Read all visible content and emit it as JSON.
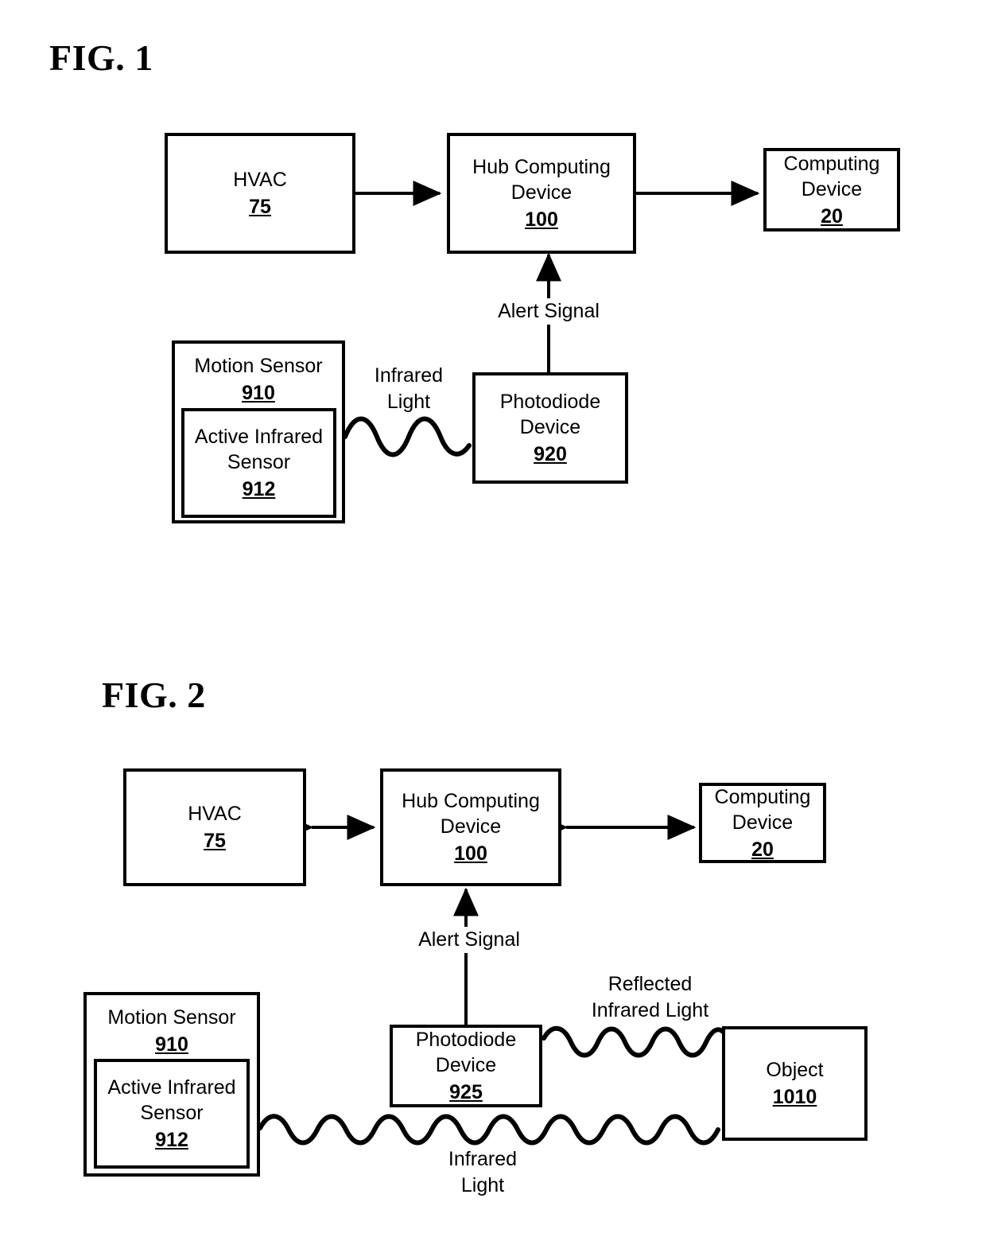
{
  "document": {
    "type": "patent-figure-sheet",
    "figures": [
      {
        "id": "fig1",
        "title": "FIG. 1",
        "nodes": [
          {
            "id": "hvac",
            "title": "HVAC",
            "ref": "75"
          },
          {
            "id": "hub",
            "title": "Hub Computing\nDevice",
            "ref": "100"
          },
          {
            "id": "computing",
            "title": "Computing\nDevice",
            "ref": "20"
          },
          {
            "id": "motion",
            "title": "Motion Sensor",
            "ref": "910"
          },
          {
            "id": "activeir",
            "title": "Active\nInfrared\nSensor",
            "ref": "912"
          },
          {
            "id": "photodiode",
            "title": "Photodiode\nDevice",
            "ref": "920"
          }
        ],
        "edge_labels": [
          {
            "id": "alert",
            "text": "Alert Signal"
          },
          {
            "id": "infrared",
            "text": "Infrared\nLight"
          }
        ]
      },
      {
        "id": "fig2",
        "title": "FIG. 2",
        "nodes": [
          {
            "id": "hvac",
            "title": "HVAC",
            "ref": "75"
          },
          {
            "id": "hub",
            "title": "Hub Computing\nDevice",
            "ref": "100"
          },
          {
            "id": "computing",
            "title": "Computing\nDevice",
            "ref": "20"
          },
          {
            "id": "motion",
            "title": "Motion Sensor",
            "ref": "910"
          },
          {
            "id": "activeir",
            "title": "Active\nInfrared\nSensor",
            "ref": "912"
          },
          {
            "id": "photodiode",
            "title": "Photodiode\nDevice",
            "ref": "925"
          },
          {
            "id": "object",
            "title": "Object",
            "ref": "1010"
          }
        ],
        "edge_labels": [
          {
            "id": "alert",
            "text": "Alert Signal"
          },
          {
            "id": "reflected",
            "text": "Reflected\nInfrared Light"
          },
          {
            "id": "infrared",
            "text": "Infrared\nLight"
          }
        ]
      }
    ],
    "colors": {
      "ink": "#000000",
      "paper": "#ffffff"
    }
  }
}
